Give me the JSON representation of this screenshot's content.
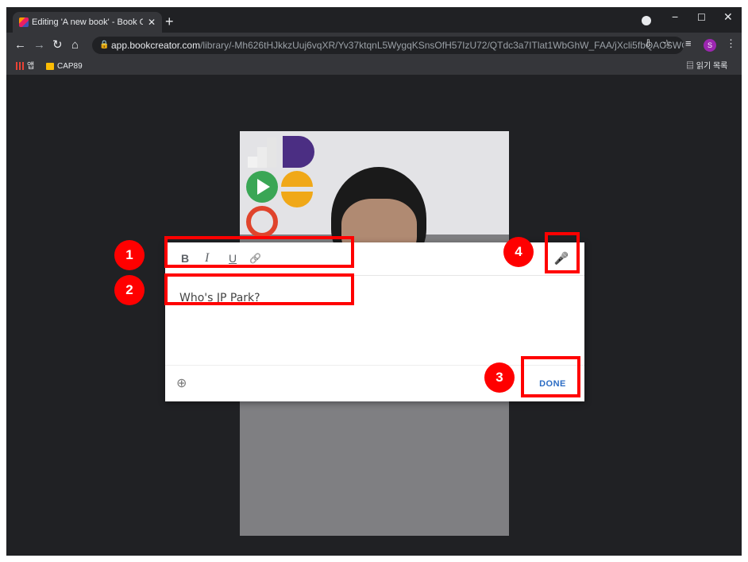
{
  "browser": {
    "tab_title": "Editing 'A new book' - Book Cr",
    "tab_close": "✕",
    "new_tab": "+",
    "window_minimize": "−",
    "window_maximize": "☐",
    "window_close": "✕",
    "url_host": "app.bookcreator.com",
    "url_path": "/library/-Mh626tHJkkzUuj6vqXR/Yv37ktqnL5WygqKSnsOfH57IzU72/QTdc3a7ITlat1WbGhW_FAA/jXcli5fbQACSWGm...",
    "profile_initial": "S",
    "bookmarks": {
      "apps_label": "앱",
      "folder_label": "CAP89",
      "reading_list_label": "읽기 목록"
    }
  },
  "editor": {
    "toolbar": {
      "bold": "B",
      "italic": "I",
      "underline": "U",
      "link": "🔗"
    },
    "text_value": "Who's JP Park?",
    "done_label": "DONE",
    "zoom_icon": "⊕",
    "mic_icon": "🎤"
  },
  "annotations": [
    {
      "number": "1",
      "target": "text-format-toolbar"
    },
    {
      "number": "2",
      "target": "text-input"
    },
    {
      "number": "3",
      "target": "done-button"
    },
    {
      "number": "4",
      "target": "microphone-button"
    }
  ],
  "colors": {
    "highlight": "#ff0000",
    "done_text": "#2b6cc4",
    "page_bg": "#202124"
  }
}
